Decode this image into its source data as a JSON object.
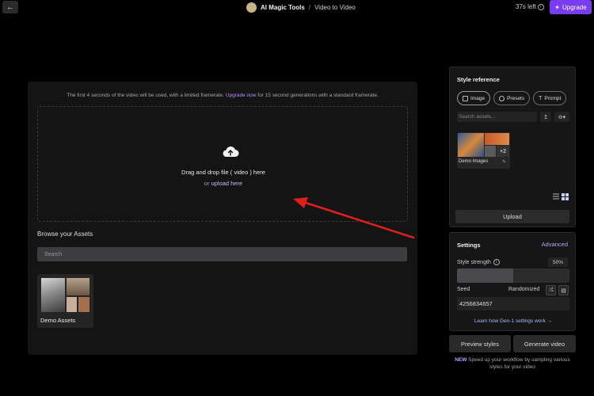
{
  "header": {
    "app_name": "AI Magic Tools",
    "separator": "/",
    "page_name": "Video to Video",
    "time_left": "37s left",
    "upgrade_label": "Upgrade"
  },
  "main": {
    "notice_prefix": "The first 4 seconds of the video will be used, with a limited framerate.",
    "notice_link": "Upgrade now",
    "notice_suffix": "for 15 second generations with a standard framerate.",
    "dropzone_title": "Drag and drop file ( video ) here",
    "dropzone_or": "or",
    "dropzone_upload": "upload here",
    "browse_title": "Browse your Assets",
    "search_placeholder": "Search",
    "assets": [
      {
        "name": "Demo Assets"
      }
    ]
  },
  "style_reference": {
    "title": "Style reference",
    "tabs": [
      {
        "label": "Image",
        "icon": "image-icon"
      },
      {
        "label": "Presets",
        "icon": "palette-icon"
      },
      {
        "label": "Prompt",
        "icon": "text-icon"
      }
    ],
    "search_placeholder": "Search assets...",
    "ref_cards": [
      {
        "name": "Demo Images",
        "more": "+2"
      }
    ],
    "upload_label": "Upload"
  },
  "settings": {
    "title": "Settings",
    "advanced_label": "Advanced",
    "strength_label": "Style strength",
    "strength_value": "50%",
    "strength_fraction": 0.5,
    "seed_label": "Seed",
    "randomized_label": "Randomized",
    "seed_value": "4256834657",
    "learn_link": "Learn how Gen-1 settings work →"
  },
  "actions": {
    "preview_label": "Preview styles",
    "generate_label": "Generate video"
  },
  "promo": {
    "new_tag": "NEW",
    "text": "Speed up your workflow by sampling various styles for your video"
  },
  "colors": {
    "accent": "#7a3cf0",
    "arrow": "#e01e1e",
    "link": "#b38cff"
  }
}
